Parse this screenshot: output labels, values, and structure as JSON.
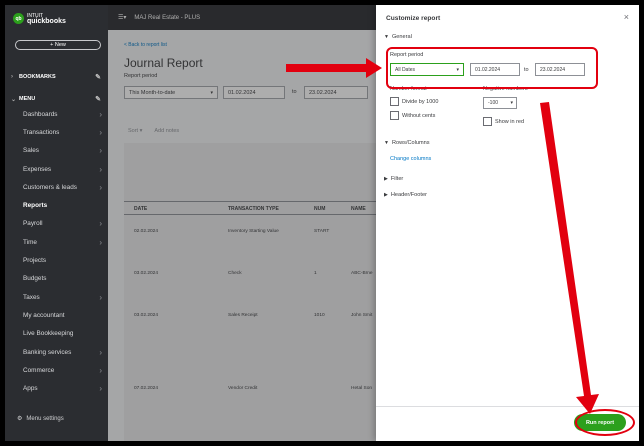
{
  "sidebar": {
    "brand_small": "INTUIT",
    "brand": "quickbooks",
    "new_label": "New",
    "bookmarks_label": "BOOKMARKS",
    "menu_label": "MENU",
    "items": [
      {
        "label": "Dashboards"
      },
      {
        "label": "Transactions"
      },
      {
        "label": "Sales"
      },
      {
        "label": "Expenses"
      },
      {
        "label": "Customers & leads"
      },
      {
        "label": "Reports"
      },
      {
        "label": "Payroll"
      },
      {
        "label": "Time"
      },
      {
        "label": "Projects"
      },
      {
        "label": "Budgets"
      },
      {
        "label": "Taxes"
      },
      {
        "label": "My accountant"
      },
      {
        "label": "Live Bookkeeping"
      },
      {
        "label": "Banking services"
      },
      {
        "label": "Commerce"
      },
      {
        "label": "Apps"
      }
    ],
    "settings_label": "Menu settings"
  },
  "topbar": {
    "company": "MAJ Real Estate - PLUS"
  },
  "report": {
    "back_link": "< Back to report list",
    "title": "Journal Report",
    "period_label": "Report period",
    "period_value": "This Month-to-date",
    "from_date": "01.02.2024",
    "to_label": "to",
    "to_date": "23.02.2024",
    "sort_label": "Sort",
    "add_notes_label": "Add notes",
    "columns": [
      "DATE",
      "TRANSACTION TYPE",
      "NUM",
      "NAME"
    ],
    "rows": [
      [
        "02.02.2024",
        "Inventory Starting Value",
        "START",
        ""
      ],
      [
        "03.02.2024",
        "Check",
        "1",
        "ABC-Brne"
      ],
      [
        "03.02.2024",
        "Sales Receipt",
        "1010",
        "John Smit"
      ],
      [
        "07.02.2024",
        "Vendor Credit",
        "",
        "Hetal Son"
      ]
    ]
  },
  "panel": {
    "title": "Customize report",
    "close_glyph": "×",
    "general_label": "General",
    "report_period_label": "Report period",
    "period_select": "All Dates",
    "from_date": "01.02.2024",
    "to_label": "to",
    "to_date": "23.02.2024",
    "number_format_label": "Number format",
    "negative_numbers_label": "Negative numbers",
    "divide_1000_label": "Divide by 1000",
    "without_cents_label": "Without cents",
    "negative_select": "-100",
    "show_in_red_label": "Show in red",
    "rows_columns_label": "Rows/Columns",
    "change_columns_label": "Change columns",
    "filter_label": "Filter",
    "header_footer_label": "Header/Footer",
    "run_button_label": "Run report"
  },
  "colors": {
    "brand_green": "#2ca01c",
    "annotation_red": "#e2000f",
    "sidebar_bg": "#2b2d31",
    "link_blue": "#0077c5"
  }
}
